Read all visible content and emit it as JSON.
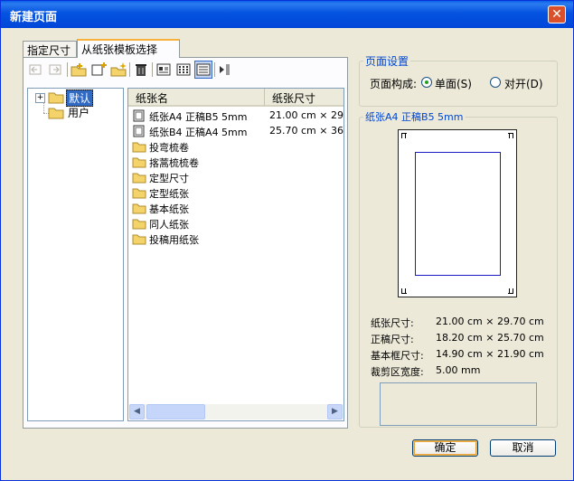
{
  "window": {
    "title": "新建页面",
    "close_glyph": "✕"
  },
  "tabs": [
    {
      "label": "指定尺寸"
    },
    {
      "label": "从纸张模板选择",
      "active": true
    }
  ],
  "toolbar": {
    "items": [
      "back-icon",
      "forward-icon",
      "new-folder-icon",
      "new-page-icon",
      "new-template-icon",
      "delete-icon",
      "large-icons-view-icon",
      "small-icons-view-icon",
      "details-view-icon",
      "up-arrow-icon"
    ]
  },
  "tree": {
    "items": [
      {
        "label": "默认",
        "expander": "+",
        "selected": true
      },
      {
        "label": "用户"
      }
    ]
  },
  "list": {
    "columns": [
      "纸张名",
      "纸张尺寸"
    ],
    "rows": [
      {
        "type": "page",
        "name": "纸张A4 正稿B5 5mm",
        "size": "21.00 cm × 29"
      },
      {
        "type": "page",
        "name": "纸张B4 正稿A4 5mm",
        "size": "25.70 cm × 36"
      },
      {
        "type": "folder",
        "name": "投弯梳卷",
        "size": ""
      },
      {
        "type": "folder",
        "name": "揢蒿梳梳卷",
        "size": ""
      },
      {
        "type": "folder",
        "name": "定型尺寸",
        "size": ""
      },
      {
        "type": "folder",
        "name": "定型纸张",
        "size": ""
      },
      {
        "type": "folder",
        "name": "基本纸张",
        "size": ""
      },
      {
        "type": "folder",
        "name": "同人纸张",
        "size": ""
      },
      {
        "type": "folder",
        "name": "投稿用纸张",
        "size": ""
      }
    ],
    "scroll_left": "◀",
    "scroll_right": "▶"
  },
  "page_settings": {
    "title": "页面设置",
    "label": "页面构成:",
    "options": [
      {
        "label": "单面(S)",
        "selected": true
      },
      {
        "label": "对开(D)",
        "selected": false
      }
    ]
  },
  "preview": {
    "title": "纸张A4 正稿B5 5mm",
    "stats": [
      {
        "label": "纸张尺寸:",
        "value": "21.00 cm × 29.70 cm"
      },
      {
        "label": "正稿尺寸:",
        "value": "18.20 cm × 25.70 cm"
      },
      {
        "label": "基本框尺寸:",
        "value": "14.90 cm × 21.90 cm"
      },
      {
        "label": "裁剪区宽度:",
        "value": "5.00 mm"
      }
    ]
  },
  "buttons": {
    "ok": "确定",
    "cancel": "取消"
  },
  "colors": {
    "title_bar": "#0054E3",
    "accent_text": "#0046D5",
    "selection": "#316AC5",
    "frame_line": "#1A1A8F"
  }
}
